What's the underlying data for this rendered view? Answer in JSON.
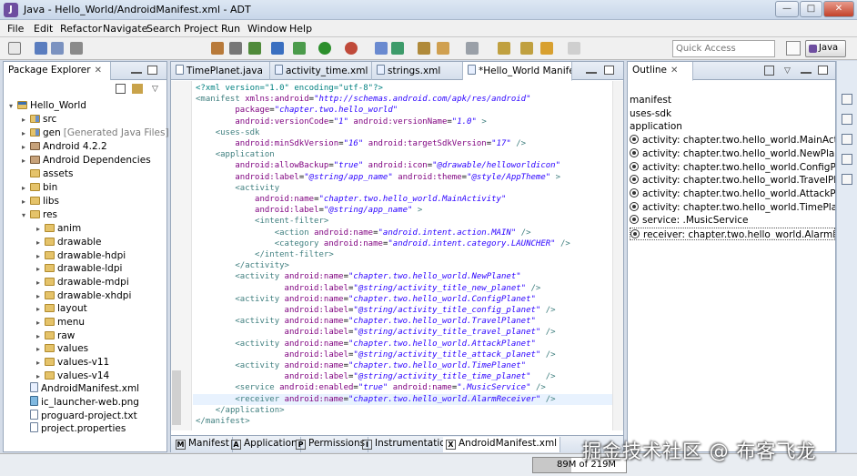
{
  "window": {
    "title": "Java - Hello_World/AndroidManifest.xml - ADT"
  },
  "menu": [
    "File",
    "Edit",
    "Refactor",
    "Navigate",
    "Search",
    "Project",
    "Run",
    "Window",
    "Help"
  ],
  "toolbar": {
    "quick_access_placeholder": "Quick Access",
    "perspective": "Java"
  },
  "package_explorer": {
    "title": "Package Explorer",
    "items": [
      {
        "label": "Hello_World",
        "icon": "project-icon"
      },
      {
        "label": "src",
        "icon": "src-folder-icon"
      },
      {
        "label": "gen",
        "note": "[Generated Java Files]",
        "icon": "src-folder-icon"
      },
      {
        "label": "Android 4.2.2",
        "icon": "library-icon"
      },
      {
        "label": "Android Dependencies",
        "icon": "library-icon"
      },
      {
        "label": "assets",
        "icon": "folder-icon"
      },
      {
        "label": "bin",
        "icon": "folder-icon"
      },
      {
        "label": "libs",
        "icon": "folder-icon"
      },
      {
        "label": "res",
        "icon": "folder-icon"
      },
      {
        "label": "anim",
        "icon": "folder-icon"
      },
      {
        "label": "drawable",
        "icon": "folder-icon"
      },
      {
        "label": "drawable-hdpi",
        "icon": "folder-icon"
      },
      {
        "label": "drawable-ldpi",
        "icon": "folder-icon"
      },
      {
        "label": "drawable-mdpi",
        "icon": "folder-icon"
      },
      {
        "label": "drawable-xhdpi",
        "icon": "folder-icon"
      },
      {
        "label": "layout",
        "icon": "folder-icon"
      },
      {
        "label": "menu",
        "icon": "folder-icon"
      },
      {
        "label": "raw",
        "icon": "folder-icon"
      },
      {
        "label": "values",
        "icon": "folder-icon"
      },
      {
        "label": "values-v11",
        "icon": "folder-icon"
      },
      {
        "label": "values-v14",
        "icon": "folder-icon"
      },
      {
        "label": "AndroidManifest.xml",
        "icon": "xml-file-icon"
      },
      {
        "label": "ic_launcher-web.png",
        "icon": "image-file-icon"
      },
      {
        "label": "proguard-project.txt",
        "icon": "text-file-icon"
      },
      {
        "label": "project.properties",
        "icon": "text-file-icon"
      }
    ]
  },
  "editor_tabs": [
    "TimePlanet.java",
    "activity_time.xml",
    "strings.xml",
    "*Hello_World Manifest"
  ],
  "code": [
    "<?xml version=\"1.0\" encoding=\"utf-8\"?>",
    "<manifest xmlns:android=\"http://schemas.android.com/apk/res/android\"",
    "        package=\"chapter.two.hello_world\"",
    "        android:versionCode=\"1\" android:versionName=\"1.0\" >",
    "    <uses-sdk",
    "        android:minSdkVersion=\"16\" android:targetSdkVersion=\"17\" />",
    "    <application",
    "        android:allowBackup=\"true\" android:icon=\"@drawable/helloworldicon\"",
    "        android:label=\"@string/app_name\" android:theme=\"@style/AppTheme\" >",
    "        <activity",
    "            android:name=\"chapter.two.hello_world.MainActivity\"",
    "            android:label=\"@string/app_name\" >",
    "            <intent-filter>",
    "                <action android:name=\"android.intent.action.MAIN\" />",
    "                <category android:name=\"android.intent.category.LAUNCHER\" />",
    "            </intent-filter>",
    "        </activity>",
    "        <activity android:name=\"chapter.two.hello_world.NewPlanet\"",
    "                  android:label=\"@string/activity_title_new_planet\" />",
    "        <activity android:name=\"chapter.two.hello_world.ConfigPlanet\"",
    "                  android:label=\"@string/activity_title_config_planet\" />",
    "        <activity android:name=\"chapter.two.hello_world.TravelPlanet\"",
    "                  android:label=\"@string/activity_title_travel_planet\" />",
    "        <activity android:name=\"chapter.two.hello_world.AttackPlanet\"",
    "                  android:label=\"@string/activity_title_attack_planet\" />",
    "        <activity android:name=\"chapter.two.hello_world.TimePlanet\"",
    "                  android:label=\"@string/activity_title_time_planet\"   />",
    "        <service android:enabled=\"true\" android:name=\".MusicService\" />",
    "        <receiver android:name=\"chapter.two.hello_world.AlarmReceiver\" />",
    "    </application>",
    "</manifest>"
  ],
  "editor_bottom_tabs": [
    {
      "icon": "M",
      "label": "Manifest"
    },
    {
      "icon": "A",
      "label": "Application"
    },
    {
      "icon": "P",
      "label": "Permissions"
    },
    {
      "icon": "I",
      "label": "Instrumentation"
    },
    {
      "icon": "X",
      "label": "AndroidManifest.xml"
    }
  ],
  "outline": {
    "title": "Outline",
    "items": [
      "manifest",
      "uses-sdk",
      "application",
      "activity: chapter.two.hello_world.MainActivity",
      "activity: chapter.two.hello_world.NewPlanet",
      "activity: chapter.two.hello_world.ConfigPlanet",
      "activity: chapter.two.hello_world.TravelPlanet",
      "activity: chapter.two.hello_world.AttackPlanet",
      "activity: chapter.two.hello_world.TimePlanet",
      "service: .MusicService",
      "receiver: chapter.two.hello_world.AlarmReceiver"
    ]
  },
  "status": {
    "heap": "89M of 219M",
    "heap_used_fraction": 0.41
  },
  "watermark": "掘金技术社区 @ 布客飞龙"
}
